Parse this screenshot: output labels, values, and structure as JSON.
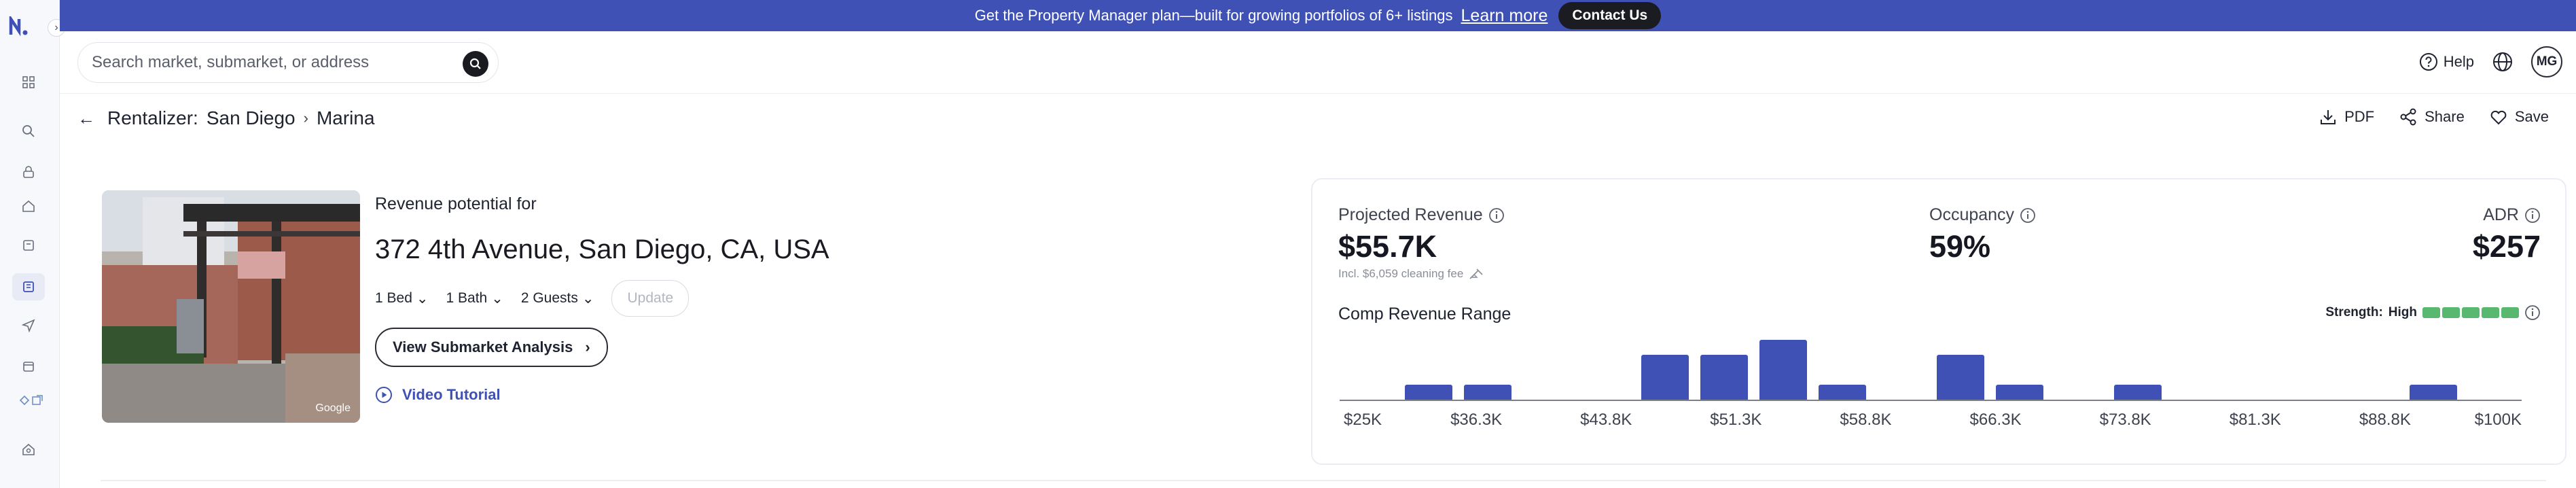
{
  "banner": {
    "message": "Get the Property Manager plan—built for growing portfolios of 6+ listings",
    "learn_more": "Learn more",
    "contact": "Contact Us"
  },
  "search": {
    "placeholder": "Search market, submarket, or address"
  },
  "topbar": {
    "help": "Help",
    "avatar_initials": "MG"
  },
  "breadcrumb": {
    "product": "Rentalizer:",
    "market": "San Diego",
    "submarket": "Marina"
  },
  "actions": {
    "pdf": "PDF",
    "share": "Share",
    "save": "Save"
  },
  "property": {
    "eyebrow": "Revenue potential for",
    "address": "372 4th Avenue, San Diego, CA, USA",
    "beds": "1 Bed",
    "baths": "1 Bath",
    "guests": "2 Guests",
    "update_label": "Update",
    "submarket_button": "View Submarket Analysis",
    "video_tutorial": "Video Tutorial",
    "photo_credit": "Google"
  },
  "metrics": {
    "projected_revenue_label": "Projected Revenue",
    "projected_revenue_value": "$55.7K",
    "cleaning_note": "Incl. $6,059 cleaning fee",
    "occupancy_label": "Occupancy",
    "occupancy_value": "59%",
    "adr_label": "ADR",
    "adr_value": "$257"
  },
  "comp_range": {
    "title": "Comp Revenue Range",
    "strength_label": "Strength:",
    "strength_value": "High",
    "strength_level": 5,
    "strength_max": 5
  },
  "chart_data": {
    "type": "bar",
    "title": "Comp Revenue Range",
    "tick_labels": [
      "$25K",
      "$36.3K",
      "$43.8K",
      "$51.3K",
      "$58.8K",
      "$66.3K",
      "$73.8K",
      "$81.3K",
      "$88.8K",
      "$100K"
    ],
    "bins": 20,
    "values": [
      0,
      1,
      1,
      0,
      0,
      3,
      3,
      4,
      1,
      0,
      3,
      1,
      0,
      1,
      0,
      0,
      0,
      0,
      1,
      0
    ]
  },
  "colors": {
    "brand": "#3f51b5",
    "strength": "#58b870"
  }
}
